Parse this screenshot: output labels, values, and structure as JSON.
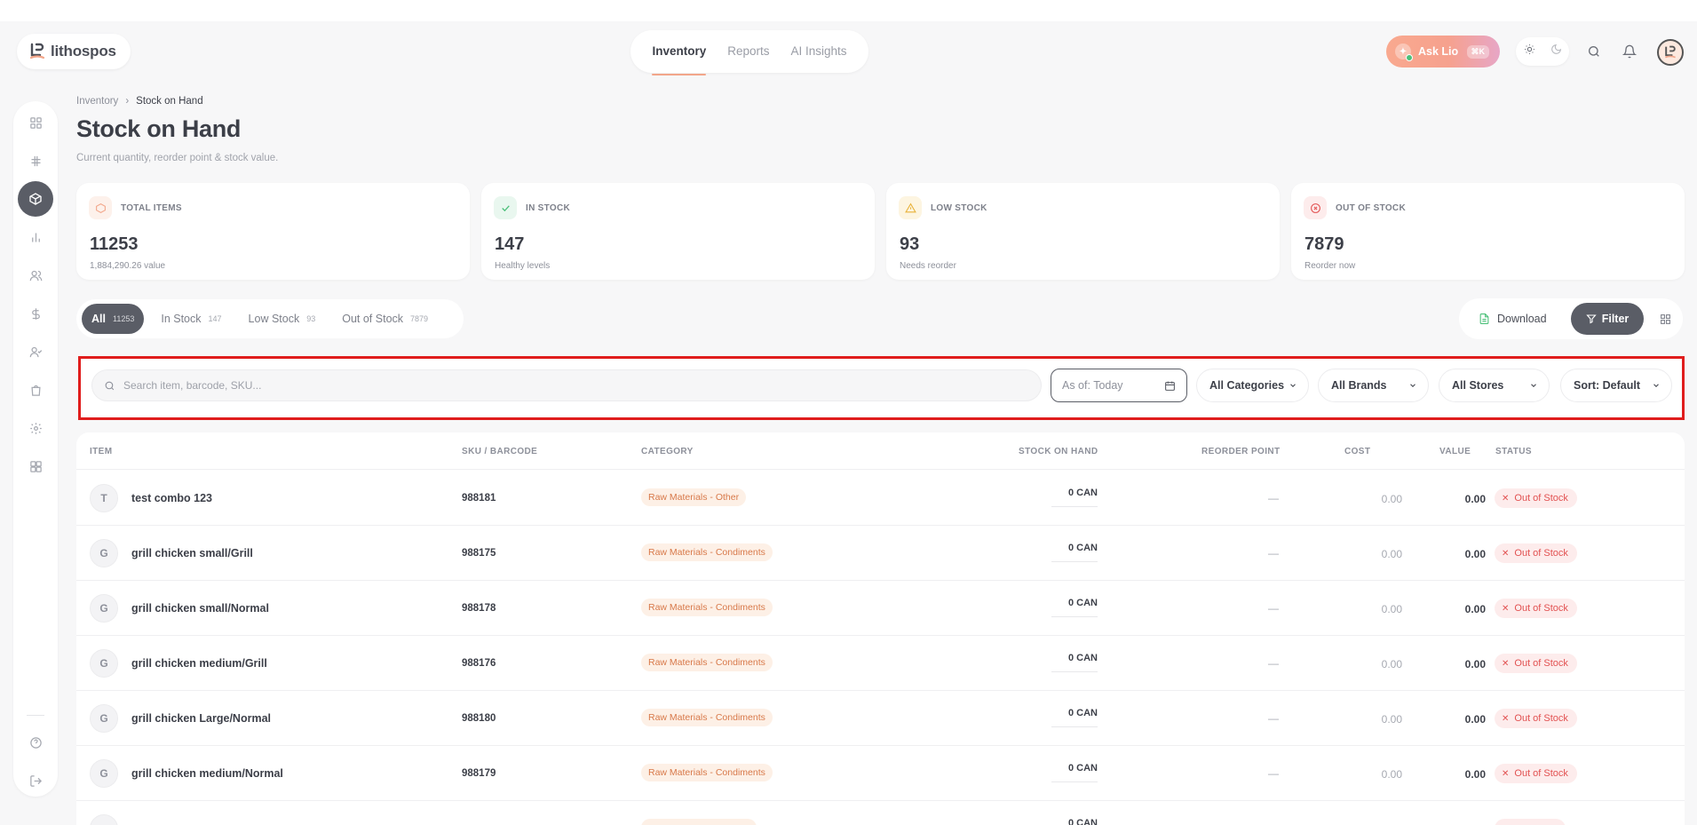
{
  "app": {
    "logo_text": "lithospos"
  },
  "topnav": {
    "tabs": [
      {
        "label": "Inventory"
      },
      {
        "label": "Reports"
      },
      {
        "label": "AI Insights"
      }
    ]
  },
  "topbar": {
    "ask_label": "Ask Lio",
    "ask_shortcut": "⌘K"
  },
  "breadcrumb": {
    "parent": "Inventory",
    "separator": "›",
    "current": "Stock on Hand"
  },
  "page": {
    "title": "Stock on Hand",
    "subtitle": "Current quantity, reorder point & stock value."
  },
  "cards": [
    {
      "label": "TOTAL ITEMS",
      "value": "11253",
      "sub": "1,884,290.26 value",
      "icon": "cube-icon",
      "color": "#f2a68a"
    },
    {
      "label": "IN STOCK",
      "value": "147",
      "sub": "Healthy levels",
      "icon": "check-icon",
      "color": "#4cc07a"
    },
    {
      "label": "LOW STOCK",
      "value": "93",
      "sub": "Needs reorder",
      "icon": "warning-icon",
      "color": "#e8b23a"
    },
    {
      "label": "OUT OF STOCK",
      "value": "7879",
      "sub": "Reorder now",
      "icon": "x-circle-icon",
      "color": "#e25151"
    }
  ],
  "filter_tabs": [
    {
      "label": "All",
      "count": "11253"
    },
    {
      "label": "In Stock",
      "count": "147"
    },
    {
      "label": "Low Stock",
      "count": "93"
    },
    {
      "label": "Out of Stock",
      "count": "7879"
    }
  ],
  "actions": {
    "download_label": "Download",
    "filter_label": "Filter"
  },
  "search": {
    "placeholder": "Search item, barcode, SKU..."
  },
  "filters": {
    "as_of": "As of: Today",
    "categories": "All Categories",
    "brands": "All Brands",
    "stores": "All Stores",
    "sort": "Sort: Default"
  },
  "table": {
    "columns": [
      "ITEM",
      "SKU / BARCODE",
      "CATEGORY",
      "STOCK ON HAND",
      "REORDER POINT",
      "COST",
      "VALUE",
      "STATUS"
    ],
    "rows": [
      {
        "initial": "T",
        "name": "test combo 123",
        "sku": "988181",
        "category": "Raw Materials - Other",
        "stock": "0 CAN",
        "reorder": "—",
        "cost": "0.00",
        "value": "0.00",
        "status": "Out of Stock"
      },
      {
        "initial": "G",
        "name": "grill chicken small/Grill",
        "sku": "988175",
        "category": "Raw Materials - Condiments",
        "stock": "0 CAN",
        "reorder": "—",
        "cost": "0.00",
        "value": "0.00",
        "status": "Out of Stock"
      },
      {
        "initial": "G",
        "name": "grill chicken small/Normal",
        "sku": "988178",
        "category": "Raw Materials - Condiments",
        "stock": "0 CAN",
        "reorder": "—",
        "cost": "0.00",
        "value": "0.00",
        "status": "Out of Stock"
      },
      {
        "initial": "G",
        "name": "grill chicken medium/Grill",
        "sku": "988176",
        "category": "Raw Materials - Condiments",
        "stock": "0 CAN",
        "reorder": "—",
        "cost": "0.00",
        "value": "0.00",
        "status": "Out of Stock"
      },
      {
        "initial": "G",
        "name": "grill chicken Large/Normal",
        "sku": "988180",
        "category": "Raw Materials - Condiments",
        "stock": "0 CAN",
        "reorder": "—",
        "cost": "0.00",
        "value": "0.00",
        "status": "Out of Stock"
      },
      {
        "initial": "G",
        "name": "grill chicken medium/Normal",
        "sku": "988179",
        "category": "Raw Materials - Condiments",
        "stock": "0 CAN",
        "reorder": "—",
        "cost": "0.00",
        "value": "0.00",
        "status": "Out of Stock"
      },
      {
        "initial": "",
        "name": "",
        "sku": "",
        "category": "",
        "stock": "0 CAN",
        "reorder": "",
        "cost": "",
        "value": "",
        "status": ""
      }
    ]
  },
  "colors": {
    "accent": "#f2a68a",
    "primary_dark": "#5a5d66",
    "highlight_border": "#e01d1d",
    "danger": "#e25151"
  }
}
